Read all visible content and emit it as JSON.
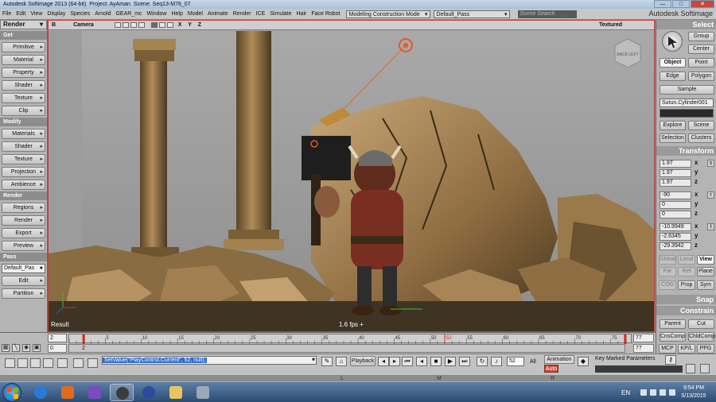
{
  "titlebar": {
    "app": "Autodesk Softimage 2013 (64-bit)",
    "project": "Project: AyAman",
    "scene": "Scene: Seq13-M76_07",
    "minimize": "—",
    "maximize": "□",
    "close": "✕"
  },
  "menubar": {
    "items": [
      "File",
      "Edit",
      "View",
      "Display",
      "Species",
      "Arnold",
      "GEAR_mc",
      "Window",
      "Help",
      "Model",
      "Animate",
      "Render",
      "ICE",
      "Simulate",
      "Hair",
      "Face Robot"
    ],
    "mode_dropdown": "Modeling Construction Mode",
    "pass_dropdown": "Default_Pass",
    "search_placeholder": "Scene Search",
    "brand": "Autodesk Softimage"
  },
  "leftpanel": {
    "header": "Render",
    "sections": [
      {
        "label": "Get",
        "items": [
          "Primitive",
          "Material",
          "Property",
          "Shader",
          "Texture",
          "Clip"
        ]
      },
      {
        "label": "Modify",
        "items": [
          "Materials",
          "Shader",
          "Texture",
          "Projection",
          "Ambience"
        ]
      },
      {
        "label": "Render",
        "items": [
          "Regions",
          "Render",
          "Export",
          "Preview"
        ]
      },
      {
        "label": "Pass",
        "pass_value": "Default_Pas",
        "items": [
          "Edit",
          "Partition"
        ]
      }
    ]
  },
  "viewport": {
    "letter": "B",
    "camera": "Camera",
    "axes": "X Y Z",
    "shading": "Textured",
    "result_label": "Result",
    "fps": "1.6  fps  +",
    "nav_cube": "BACK LEFT"
  },
  "rightpanel": {
    "select_title": "Select",
    "group": "Group",
    "center": "Center",
    "object": "Object",
    "point": "Point",
    "edge": "Edge",
    "polygon": "Polygon",
    "sample": "Sample",
    "selection_name": "Sutun.Cylinder001",
    "explore": "Explore",
    "scene": "Scene",
    "selection": "Selection",
    "clusters": "Clusters",
    "transform_title": "Transform",
    "scale": [
      "1.97",
      "1.97",
      "1.97"
    ],
    "rotate": [
      "-90",
      "0",
      "0"
    ],
    "translate": [
      "-10.9949",
      "-2.6345",
      "-29.3942"
    ],
    "axis_letters": [
      "x",
      "y",
      "z"
    ],
    "global": "Global",
    "local": "Local",
    "view": "View",
    "par": "Par",
    "ref": "Ref",
    "plane": "Plane",
    "cog": "COG",
    "prop": "Prop",
    "sym": "Sym",
    "snap_title": "Snap",
    "constrain_title": "Constrain",
    "parent": "Parent",
    "cut": "Cut",
    "cnscomp": "CnsComp",
    "chldcomp": "ChldComp",
    "mcp": "MCP",
    "kpl": "KP/L",
    "ppg": "PPG"
  },
  "timeline": {
    "start_top": "2",
    "start_bottom": "0",
    "end_top": "77",
    "end_bottom": "77",
    "ruler2_label": "2",
    "ticks": [
      5,
      10,
      15,
      20,
      25,
      30,
      35,
      40,
      45,
      50,
      55,
      60,
      65,
      70,
      75
    ],
    "current_frame_label": "52",
    "range_start": 2,
    "range_end": 77,
    "frame_min": 0,
    "frame_max": 78
  },
  "playbar": {
    "command": "SetValue(\"PlayControl.Current\", 52, null);",
    "playback": "Playback",
    "current_frame": "52",
    "all": "All",
    "animation": "Animation",
    "auto": "Auto",
    "key_marked": "Key Marked Parameters",
    "mouse_left": "L",
    "mouse_middle": "M",
    "mouse_right": "R"
  },
  "taskbar": {
    "language": "EN",
    "time": "9:54 PM",
    "date": "5/13/2015"
  }
}
